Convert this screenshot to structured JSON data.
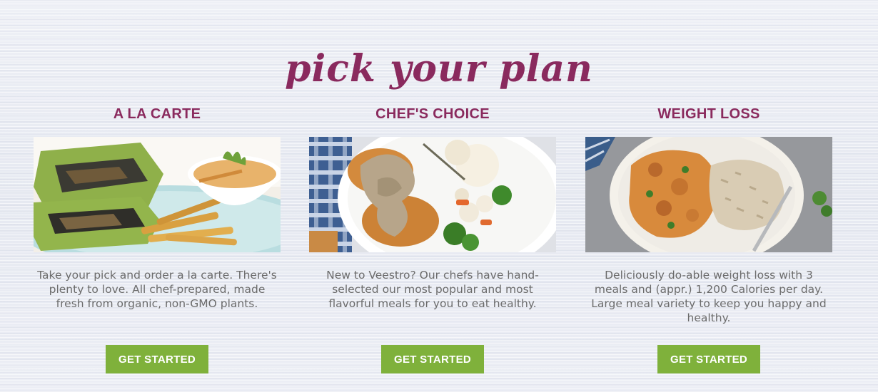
{
  "page": {
    "title": "pick your plan"
  },
  "colors": {
    "heading": "#8a2a5e",
    "button": "#7fb13b",
    "body_text": "#6b6b6b"
  },
  "plans": [
    {
      "heading": "A LA CARTE",
      "image": "veggie-wrap-with-fries-photo",
      "description": "Take your pick and order a la carte. There's plenty to love. All chef-prepared, made fresh from organic, non-GMO plants.",
      "button": "GET STARTED"
    },
    {
      "heading": "CHEF'S CHOICE",
      "image": "cutlets-gravy-mashed-potatoes-photo",
      "description": "New to Veestro? Our chefs have hand-selected our most popular and most flavorful meals for you to eat healthy.",
      "button": "GET STARTED"
    },
    {
      "heading": "WEIGHT LOSS",
      "image": "curry-with-rice-photo",
      "description": "Deliciously do-able weight loss with 3 meals and (appr.) 1,200 Calories per day. Large meal variety to keep you happy and healthy.",
      "button": "GET STARTED"
    }
  ]
}
